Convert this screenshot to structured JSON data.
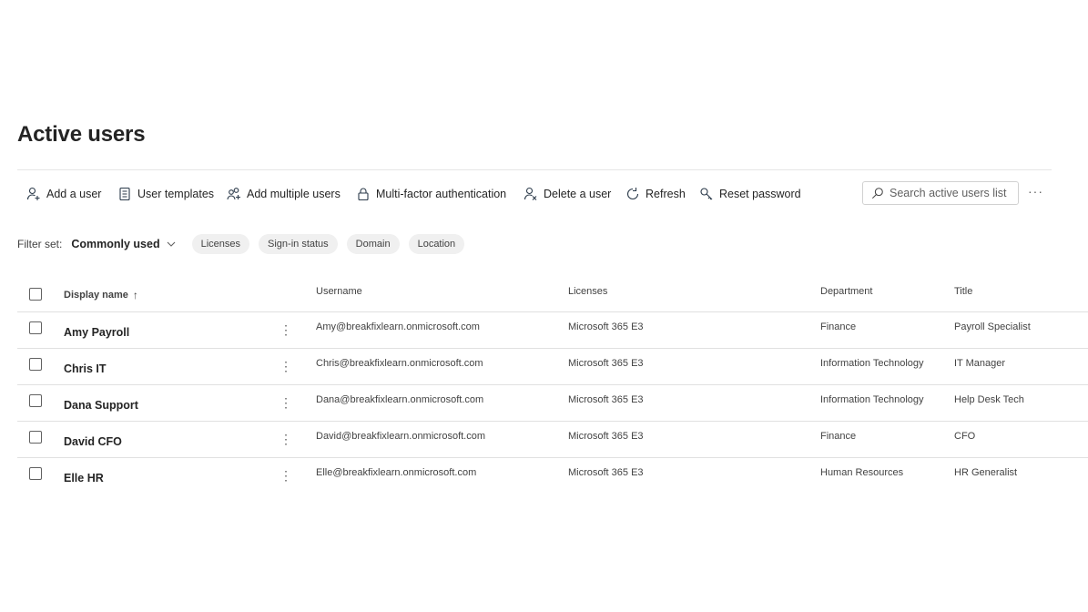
{
  "page": {
    "title": "Active users"
  },
  "toolbar": {
    "add_user": "Add a user",
    "user_templates": "User templates",
    "add_multiple": "Add multiple users",
    "mfa": "Multi-factor authentication",
    "delete_user": "Delete a user",
    "refresh": "Refresh",
    "reset_password": "Reset password",
    "search_placeholder": "Search active users list",
    "more": "···"
  },
  "filter": {
    "label": "Filter set:",
    "value": "Commonly used",
    "chips": [
      "Licenses",
      "Sign-in status",
      "Domain",
      "Location"
    ]
  },
  "table": {
    "columns": {
      "display_name": "Display name",
      "sort_indicator": "↑",
      "username": "Username",
      "licenses": "Licenses",
      "department": "Department",
      "title": "Title"
    },
    "row_menu": "⋮",
    "rows": [
      {
        "name": "Amy Payroll",
        "username": "Amy@breakfixlearn.onmicrosoft.com",
        "license": "Microsoft 365 E3",
        "department": "Finance",
        "title": "Payroll Specialist"
      },
      {
        "name": "Chris IT",
        "username": "Chris@breakfixlearn.onmicrosoft.com",
        "license": "Microsoft 365 E3",
        "department": "Information Technology",
        "title": "IT Manager"
      },
      {
        "name": "Dana Support",
        "username": "Dana@breakfixlearn.onmicrosoft.com",
        "license": "Microsoft 365 E3",
        "department": "Information Technology",
        "title": "Help Desk Tech"
      },
      {
        "name": "David CFO",
        "username": "David@breakfixlearn.onmicrosoft.com",
        "license": "Microsoft 365 E3",
        "department": "Finance",
        "title": "CFO"
      },
      {
        "name": "Elle HR",
        "username": "Elle@breakfixlearn.onmicrosoft.com",
        "license": "Microsoft 365 E3",
        "department": "Human Resources",
        "title": "HR Generalist"
      }
    ]
  },
  "colors": {
    "icon": "#2b3a4a",
    "text": "#242424",
    "divider": "#e0e0e0",
    "chip_bg": "#f0f0f0"
  }
}
